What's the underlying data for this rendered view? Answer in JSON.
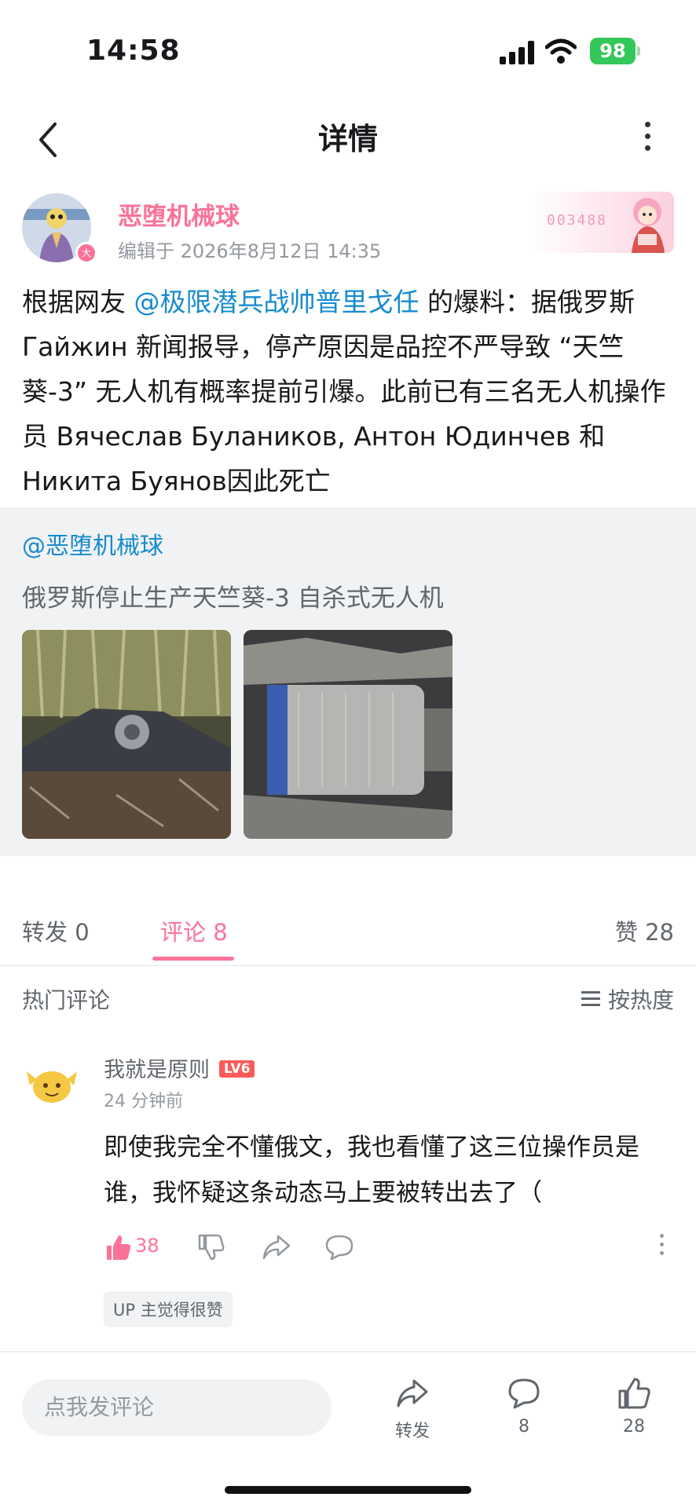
{
  "status_bar": {
    "time": "14:58",
    "battery": "98"
  },
  "nav": {
    "title": "详情"
  },
  "author": {
    "name": "恶堕机械球",
    "meta": "编辑于 2026年8月12日 14:35",
    "badge": "大",
    "fan_number": "003488"
  },
  "post": {
    "prefix": "根据网友 ",
    "mention": "@极限潜兵战帅普里戈任",
    "body": " 的爆料：据俄罗斯 Гайжин 新闻报导，停产原因是品控不严导致 “天竺葵-3” 无人机有概率提前引爆。此前已有三名无人机操作员 Вячеслав Булаников, Антон Юдинчев 和 Никита Буянов因此死亡"
  },
  "forward": {
    "author": "@恶堕机械球",
    "title": "俄罗斯停止生产天竺葵-3 自杀式无人机"
  },
  "tabs": {
    "forward": "转发 0",
    "comment": "评论 8",
    "like": "赞 28"
  },
  "comments_header": {
    "title": "热门评论",
    "sort": "按热度"
  },
  "comment": {
    "username": "我就是原则",
    "level": "LV6",
    "time": "24 分钟前",
    "text": "即使我完全不懂俄文，我也看懂了这三位操作员是谁，我怀疑这条动态马上要被转出去了（",
    "likes": "38",
    "up_tag": "UP 主觉得很赞"
  },
  "bottom": {
    "placeholder": "点我发评论",
    "forward_label": "转发",
    "comment_count": "8",
    "like_count": "28"
  },
  "colors": {
    "accent": "#fb7299",
    "link": "#178bcf",
    "battery": "#34c759"
  }
}
